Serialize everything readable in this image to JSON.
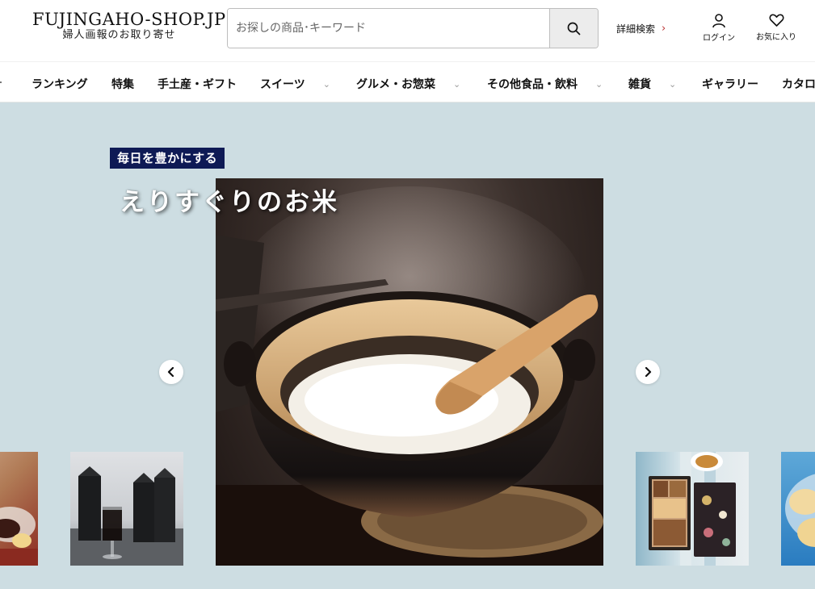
{
  "header": {
    "logo_main": "FUJINGAHO-SHOP.JP",
    "logo_sub": "婦人画報のお取り寄せ",
    "search_placeholder": "お探しの商品･キーワード",
    "advanced_search": "詳細検索",
    "login_label": "ログイン",
    "favorites_label": "お気に入り"
  },
  "nav": {
    "items": [
      {
        "label": "ランキング"
      },
      {
        "label": "特集"
      },
      {
        "label": "手土産・ギフト"
      },
      {
        "label": "スイーツ"
      },
      {
        "label": "グルメ・お惣菜"
      },
      {
        "label": "その他食品・飲料"
      },
      {
        "label": "雑貨"
      },
      {
        "label": "ギャラリー"
      },
      {
        "label": "カタログ"
      }
    ]
  },
  "hero": {
    "badge": "毎日を豊かにする",
    "title": "えりすぐりのお米"
  },
  "colors": {
    "badge_bg": "#0e1a55",
    "hero_bg": "#cddde2",
    "accent_chevron": "#b33333"
  },
  "icons": {
    "search": "search-icon",
    "user": "user-icon",
    "heart": "heart-icon",
    "prev": "chevron-left-icon",
    "next": "chevron-right-icon"
  }
}
